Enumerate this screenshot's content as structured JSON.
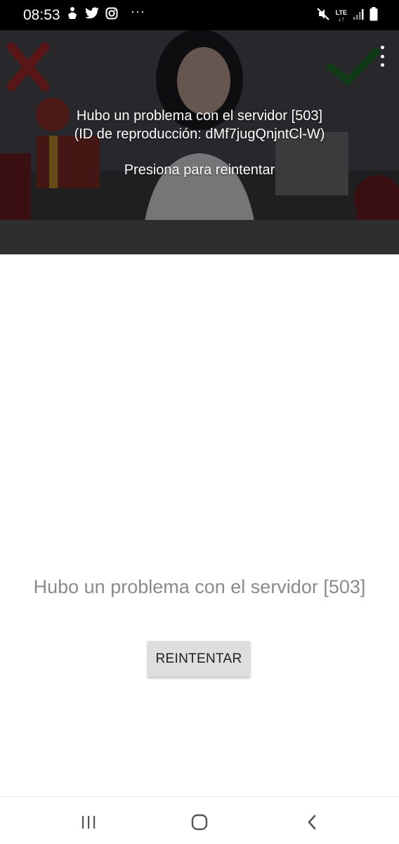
{
  "status_bar": {
    "time": "08:53",
    "left_icons": [
      "notification-icon",
      "twitter-icon",
      "instagram-icon"
    ],
    "more": "···",
    "network": "LTE",
    "right_icons": [
      "mute-icon",
      "lte-icon",
      "signal-icon",
      "battery-icon"
    ]
  },
  "player": {
    "error_title": "Hubo un problema con el servidor [503]",
    "error_id": "(ID de reproducción: dMf7jugQnjntCl-W)",
    "retry_prompt": "Presiona para reintentar"
  },
  "main": {
    "error_message": "Hubo un problema con el servidor [503]",
    "retry_button": "REINTENTAR"
  },
  "nav_bar": {
    "buttons": [
      "recents-icon",
      "home-icon",
      "back-icon"
    ]
  },
  "colors": {
    "status_bar_bg": "#000000",
    "error_text": "#8a8a8a",
    "button_bg": "#dedede"
  }
}
